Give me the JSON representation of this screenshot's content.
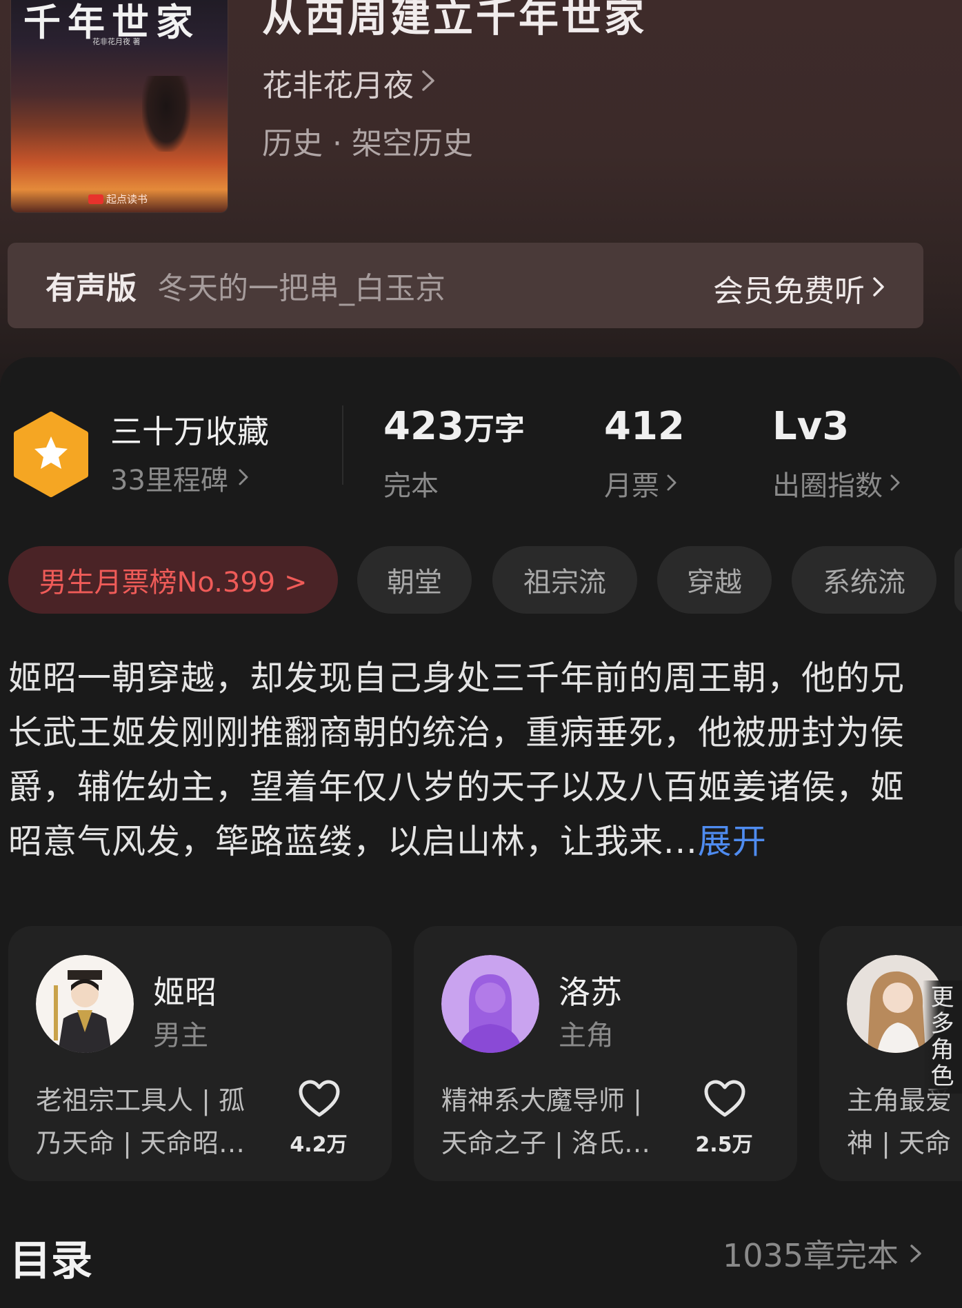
{
  "book": {
    "cover_title": "千年世家",
    "cover_author": "花非花月夜 著",
    "cover_publisher": "起点读书",
    "title": "从西周建立千年世家",
    "author": "花非花月夜",
    "genre": "历史 · 架空历史"
  },
  "audio": {
    "label": "有声版",
    "narrator": "冬天的一把串_白玉京",
    "action": "会员免费听"
  },
  "stats": {
    "collect": "三十万收藏",
    "milestone": "33里程碑",
    "words_value": "423",
    "words_unit": "万字",
    "words_label": "完本",
    "tickets_value": "412",
    "tickets_label": "月票",
    "level_value": "Lv3",
    "level_label": "出圈指数"
  },
  "tags": {
    "rank": "男生月票榜No.399 >",
    "items": [
      "朝堂",
      "祖宗流",
      "穿越",
      "系统流"
    ]
  },
  "synopsis": {
    "text": "姬昭一朝穿越，却发现自己身处三千年前的周王朝，他的兄长武王姬发刚刚推翻商朝的统治，重病垂死，他被册封为侯爵，辅佐幼主，望着年仅八岁的天子以及八百姬姜诸侯，姬昭意气风发，筚路蓝缕，以启山林，让我来...",
    "more": "展开"
  },
  "characters": [
    {
      "name": "姬昭",
      "role": "男主",
      "desc_line1": "老祖宗工具人 | 孤",
      "desc_line2": "乃天命 | 天命昭…",
      "likes": "4.2万"
    },
    {
      "name": "洛苏",
      "role": "主角",
      "desc_line1": "精神系大魔导师 |",
      "desc_line2": "天命之子 | 洛氏…",
      "likes": "2.5万"
    },
    {
      "name": "",
      "role": "",
      "desc_line1": "主角最爱",
      "desc_line2": "神 | 天命",
      "likes": ""
    }
  ],
  "more_roles": "更多角色",
  "catalog": {
    "title": "目录",
    "count": "1035章完本"
  },
  "colors": {
    "accent_link": "#4f8cf0",
    "rank_text": "#ef5b58",
    "badge_orange": "#f5a623"
  }
}
